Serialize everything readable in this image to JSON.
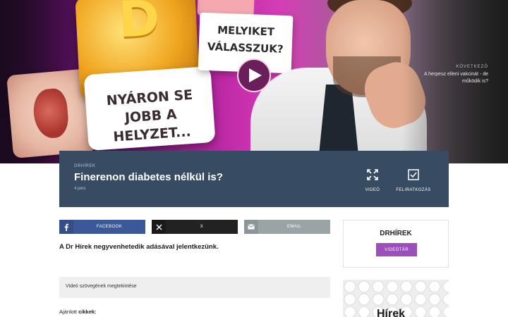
{
  "hero": {
    "thumbnail": {
      "card_main_text": "NYÁRON SE JOBB A HELYZET...",
      "card_question_text": "MELYIKET VÁLASSZUK?",
      "vitamin_letter": "D"
    },
    "next": {
      "label": "KÖVETKEZŐ",
      "title": "A herpesz elleni vakcinát - de működik is?"
    },
    "play_icon": "play-icon"
  },
  "video": {
    "category": "DRHÍREK",
    "title": "Finerenon diabetes nélkül is?",
    "duration": "4 perc",
    "actions": {
      "video_label": "VIDEÓ",
      "subscribe_label": "FELIRATKOZÁS"
    }
  },
  "share": {
    "facebook_label": "FACEBOOK",
    "x_label": "X",
    "email_label": "EMAIL"
  },
  "article": {
    "intro": "A Dr Hírek negyvenhetedik adásával jelentkezünk.",
    "transcript_label": "Videó szövegének megtekintése",
    "recommended_prefix": "Ajánlott ",
    "recommended_bold": "cikkek:"
  },
  "sidebar": {
    "brand": "DRHÍREK",
    "archive_button": "VIDEÓTÁR",
    "image_text": "Hírek"
  },
  "colors": {
    "infobar": "#374b63",
    "facebook": "#3b5998",
    "x": "#222222",
    "email": "#9aa4a6",
    "accent": "#9b4fb8"
  }
}
